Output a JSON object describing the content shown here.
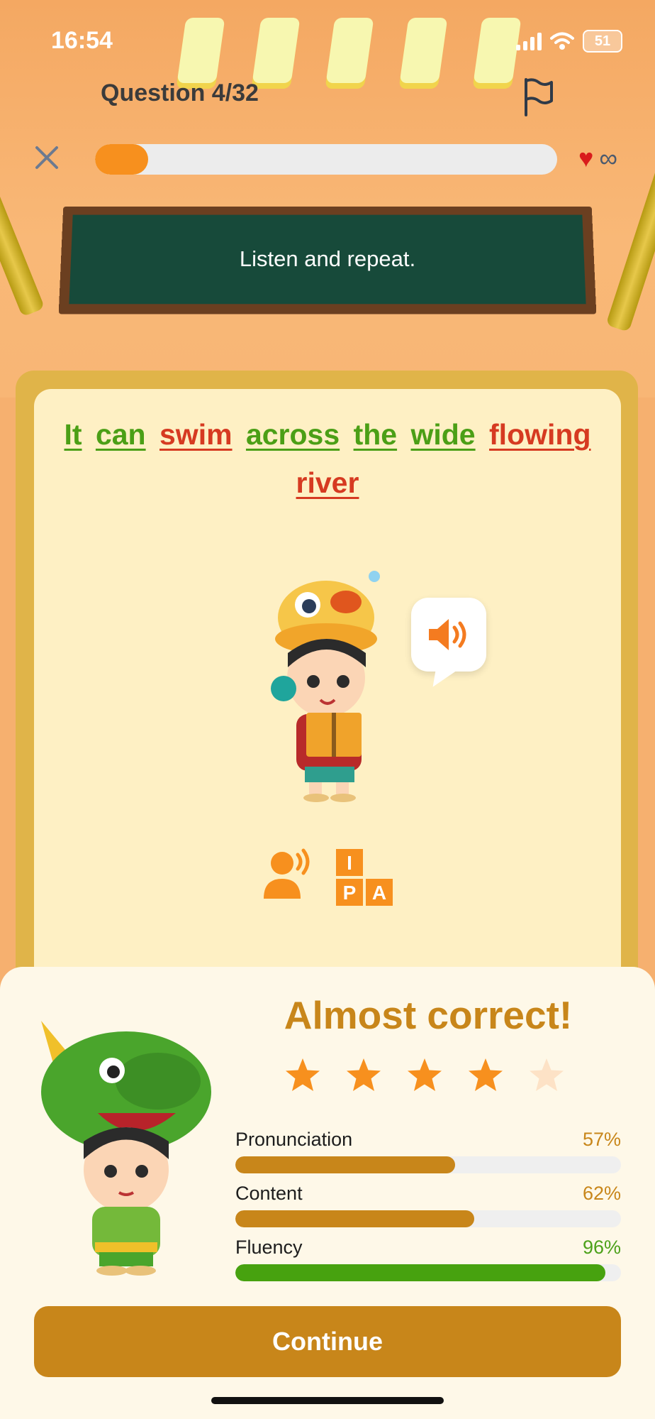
{
  "status_bar": {
    "time": "16:54",
    "battery": "51"
  },
  "header": {
    "question": "Question 4/32",
    "progress_fraction": 0.115,
    "lives": "∞"
  },
  "instruction": "Listen and repeat.",
  "sentence": [
    {
      "text": "It",
      "status": "good"
    },
    {
      "text": "can",
      "status": "good"
    },
    {
      "text": "swim",
      "status": "bad"
    },
    {
      "text": "across",
      "status": "good"
    },
    {
      "text": "the",
      "status": "good"
    },
    {
      "text": "wide",
      "status": "good"
    },
    {
      "text": "flowing",
      "status": "bad"
    },
    {
      "text": "river",
      "status": "bad"
    }
  ],
  "tools": {
    "ipa_letters": [
      "I",
      "P",
      "A"
    ]
  },
  "result": {
    "title": "Almost correct!",
    "stars_filled": 4,
    "stars_total": 5,
    "metrics": [
      {
        "label": "Pronunciation",
        "value": "57%",
        "fraction": 0.57,
        "color": "#c8861a"
      },
      {
        "label": "Content",
        "value": "62%",
        "fraction": 0.62,
        "color": "#c8861a"
      },
      {
        "label": "Fluency",
        "value": "96%",
        "fraction": 0.96,
        "color": "#47a20f"
      }
    ],
    "continue_label": "Continue"
  },
  "colors": {
    "accent_orange": "#f7901e",
    "gold": "#c8861a",
    "good": "#4b9f16",
    "bad": "#d63a21"
  }
}
